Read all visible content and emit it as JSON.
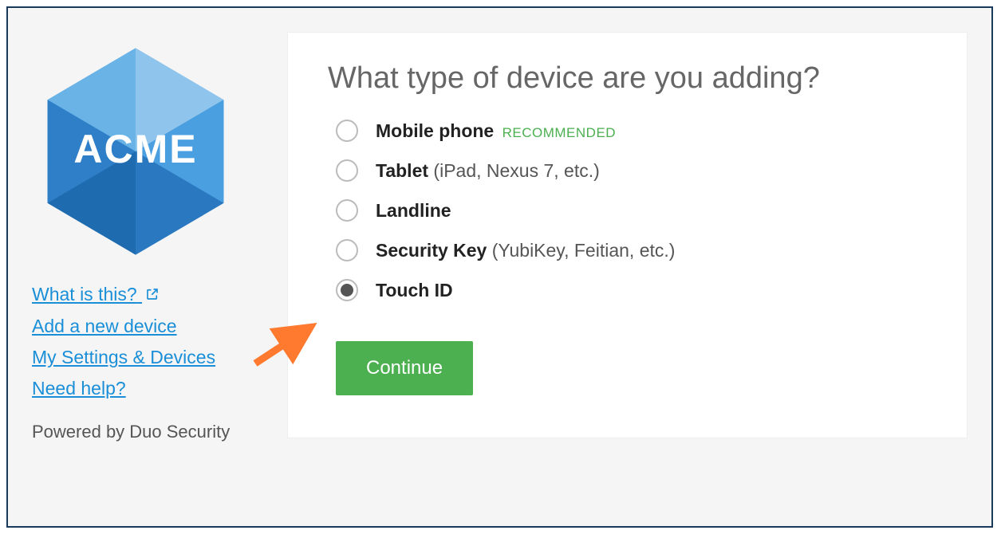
{
  "sidebar": {
    "logo_text": "ACME",
    "links": {
      "what_is_this": "What is this?",
      "add_device": "Add a new device",
      "my_settings": "My Settings & Devices",
      "need_help": "Need help?"
    },
    "powered_by": "Powered by Duo Security"
  },
  "main": {
    "heading": "What type of device are you adding?",
    "options": [
      {
        "label": "Mobile phone",
        "detail": "",
        "badge": "RECOMMENDED",
        "selected": false
      },
      {
        "label": "Tablet",
        "detail": " (iPad, Nexus 7, etc.)",
        "badge": "",
        "selected": false
      },
      {
        "label": "Landline",
        "detail": "",
        "badge": "",
        "selected": false
      },
      {
        "label": "Security Key",
        "detail": " (YubiKey, Feitian, etc.)",
        "badge": "",
        "selected": false
      },
      {
        "label": "Touch ID",
        "detail": "",
        "badge": "",
        "selected": true
      }
    ],
    "continue_label": "Continue"
  }
}
